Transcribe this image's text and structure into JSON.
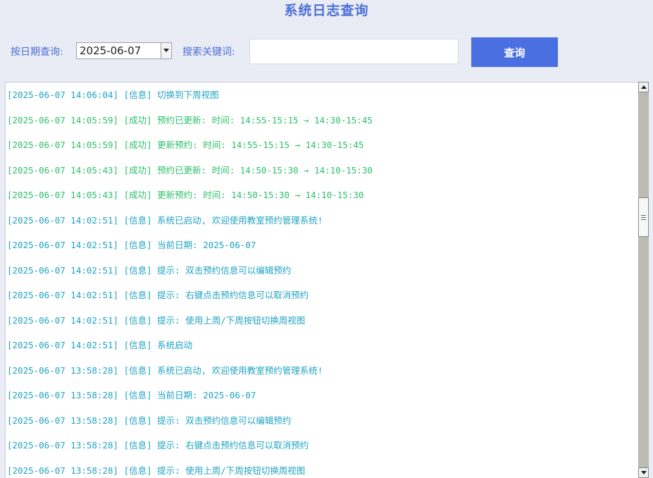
{
  "header": {
    "title": "系统日志查询"
  },
  "toolbar": {
    "date_label": "按日期查询:",
    "date_value": "2025-06-07",
    "keyword_label": "搜索关键词:",
    "keyword_value": "",
    "keyword_placeholder": "",
    "query_label": "查询"
  },
  "log": {
    "lines": [
      {
        "text": "[2025-06-07 14:06:04] [信息] 切换到下周视图",
        "level": "info"
      },
      {
        "text": "[2025-06-07 14:05:59] [成功] 预约已更新: 时间: 14:55-15:15 → 14:30-15:45",
        "level": "success"
      },
      {
        "text": "[2025-06-07 14:05:59] [成功] 更新预约: 时间: 14:55-15:15 → 14:30-15:45",
        "level": "success"
      },
      {
        "text": "[2025-06-07 14:05:43] [成功] 预约已更新: 时间: 14:50-15:30 → 14:10-15:30",
        "level": "success"
      },
      {
        "text": "[2025-06-07 14:05:43] [成功] 更新预约: 时间: 14:50-15:30 → 14:10-15:30",
        "level": "success"
      },
      {
        "text": "[2025-06-07 14:02:51] [信息] 系统已启动, 欢迎使用教室预约管理系统!",
        "level": "info"
      },
      {
        "text": "[2025-06-07 14:02:51] [信息] 当前日期: 2025-06-07",
        "level": "info"
      },
      {
        "text": "[2025-06-07 14:02:51] [信息] 提示: 双击预约信息可以编辑预约",
        "level": "info"
      },
      {
        "text": "[2025-06-07 14:02:51] [信息] 提示: 右键点击预约信息可以取消预约",
        "level": "info"
      },
      {
        "text": "[2025-06-07 14:02:51] [信息] 提示: 使用上周/下周按钮切换周视图",
        "level": "info"
      },
      {
        "text": "[2025-06-07 14:02:51] [信息] 系统启动",
        "level": "info"
      },
      {
        "text": "[2025-06-07 13:58:28] [信息] 系统已启动, 欢迎使用教室预约管理系统!",
        "level": "info"
      },
      {
        "text": "[2025-06-07 13:58:28] [信息] 当前日期: 2025-06-07",
        "level": "info"
      },
      {
        "text": "[2025-06-07 13:58:28] [信息] 提示: 双击预约信息可以编辑预约",
        "level": "info"
      },
      {
        "text": "[2025-06-07 13:58:28] [信息] 提示: 右键点击预约信息可以取消预约",
        "level": "info"
      },
      {
        "text": "[2025-06-07 13:58:28] [信息] 提示: 使用上周/下周按钮切换周视图",
        "level": "info"
      }
    ]
  },
  "colors": {
    "accent": "#4a6fd6",
    "button": "#4a6fe0",
    "info_text": "#1fa3c2",
    "success_text": "#2cc06a"
  },
  "icons": {
    "date_dropdown": "chevron-down-icon",
    "scroll_up": "scroll-up-arrow-icon",
    "scroll_down": "scroll-down-arrow-icon"
  }
}
